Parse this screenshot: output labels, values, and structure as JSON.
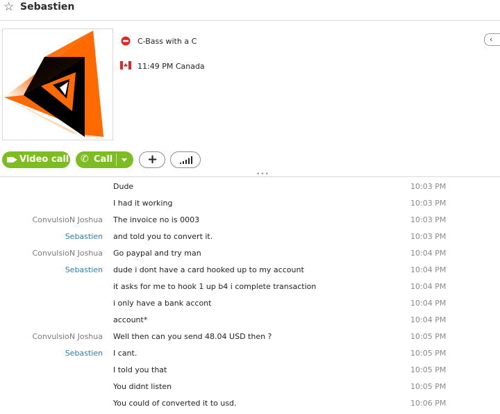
{
  "header": {
    "contact_name": "Sebastien",
    "favorite_icon": "star-outline-icon"
  },
  "profile": {
    "mood_message": "C-Bass with a C",
    "mood_icon": "skype-status-icon",
    "local_time": "11:49 PM Canada",
    "country_icon": "canada-flag-icon"
  },
  "actions": {
    "video_call_label": "Video call",
    "call_label": "Call",
    "add_icon": "plus-icon",
    "signal_icon": "signal-bars-icon"
  },
  "colors": {
    "accent_green": "#7dbd22",
    "sender_self": "#2e7fb0",
    "sender_other": "#7a7a7a"
  },
  "messages": [
    {
      "sender": "",
      "text": "Dude",
      "time": "10:03 PM",
      "from": ""
    },
    {
      "sender": "",
      "text": "I had it working",
      "time": "10:03 PM",
      "from": ""
    },
    {
      "sender": "ConvulsioN Joshua",
      "text": "The invoice no is 0003",
      "time": "10:03 PM",
      "from": "other"
    },
    {
      "sender": "Sebastien",
      "text": "and told you to convert it.",
      "time": "10:03 PM",
      "from": "me"
    },
    {
      "sender": "ConvulsioN Joshua",
      "text": "Go paypal and try man",
      "time": "10:04 PM",
      "from": "other"
    },
    {
      "sender": "Sebastien",
      "text": "dude i dont have a card hooked up to my account",
      "time": "10:04 PM",
      "from": "me"
    },
    {
      "sender": "",
      "text": "it asks for me to hook 1 up b4 i complete transaction",
      "time": "10:04 PM",
      "from": ""
    },
    {
      "sender": "",
      "text": "i only have a bank accont",
      "time": "10:04 PM",
      "from": ""
    },
    {
      "sender": "",
      "text": "account*",
      "time": "10:04 PM",
      "from": ""
    },
    {
      "sender": "ConvulsioN Joshua",
      "text": "Well then can you send 48.04 USD then ?",
      "time": "10:05 PM",
      "from": "other"
    },
    {
      "sender": "Sebastien",
      "text": "I cant.",
      "time": "10:05 PM",
      "from": "me"
    },
    {
      "sender": "",
      "text": "I told you that",
      "time": "10:05 PM",
      "from": ""
    },
    {
      "sender": "",
      "text": "You didnt listen",
      "time": "10:05 PM",
      "from": ""
    },
    {
      "sender": "",
      "text": "You could of converted it to usd.",
      "time": "10:06 PM",
      "from": ""
    }
  ]
}
